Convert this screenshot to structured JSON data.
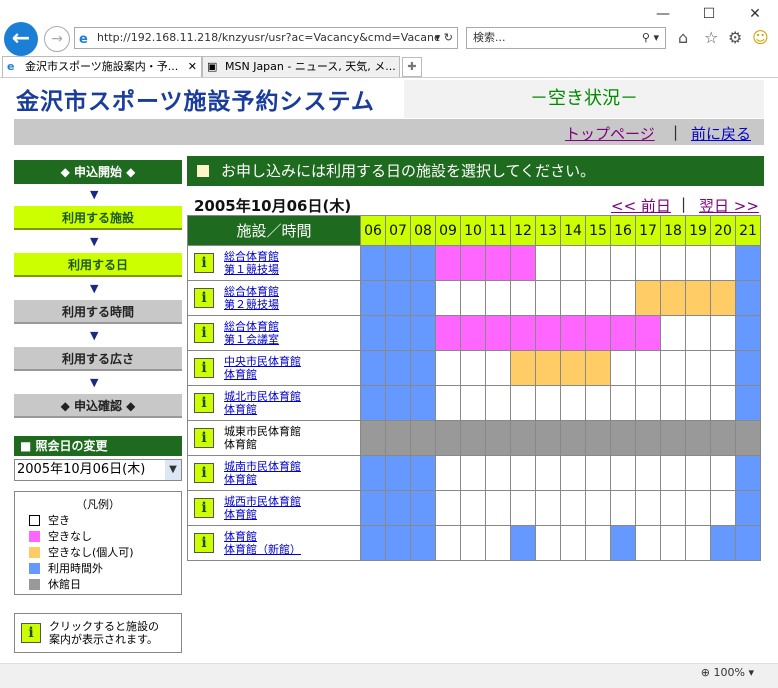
{
  "browser": {
    "address": "http://192.168.11.218/knzyusr/usr?ac=Vacancy&cmd=Vacanc",
    "search_placeholder": "検索...",
    "tabs": [
      {
        "label": "金沢市スポーツ施設案内・予...",
        "active": true
      },
      {
        "label": "MSN Japan - ニュース, 天気, メ...",
        "active": false
      }
    ],
    "zoom": "100%"
  },
  "site": {
    "logo": "金沢市スポーツ施設予約システム",
    "subtitle": "－空き状況－",
    "top_link": "トップページ",
    "back_link": "前に戻る",
    "separator": "|"
  },
  "steps": {
    "start": "◆ 申込開始 ◆",
    "facility": "利用する施設",
    "day": "利用する日",
    "time": "利用する時間",
    "area": "利用する広さ",
    "confirm": "◆ 申込確認 ◆",
    "arrow": "▼"
  },
  "date_change": {
    "header": "■ 照会日の変更",
    "selected": "2005年10月06日(木)"
  },
  "legend": {
    "title": "（凡例）",
    "items": [
      {
        "label": "空き",
        "color": "#ffffff"
      },
      {
        "label": "空きなし",
        "color": "#ff66ff"
      },
      {
        "label": "空きなし(個人可)",
        "color": "#ffcc66"
      },
      {
        "label": "利用時間外",
        "color": "#6699ff"
      },
      {
        "label": "休館日",
        "color": "#999999"
      }
    ]
  },
  "info_note": {
    "line1": "クリックすると施設の",
    "line2": "案内が表示されます。",
    "icon": "i"
  },
  "main": {
    "header": "お申し込みには利用する日の施設を選択してください。",
    "current_date": "2005年10月06日(木)",
    "prev_day": "<< 前日",
    "next_day": "翌日 >>",
    "separator": "|",
    "col_header": "施設／時間",
    "hours": [
      "06",
      "07",
      "08",
      "09",
      "10",
      "11",
      "12",
      "13",
      "14",
      "15",
      "16",
      "17",
      "18",
      "19",
      "20",
      "21"
    ],
    "status_colors": {
      "0": "#ffffff",
      "1": "#ff66ff",
      "2": "#ffcc66",
      "3": "#6699ff",
      "4": "#999999"
    },
    "facilities": [
      {
        "name1": "総合体育館",
        "name2": "第１競技場",
        "link": true,
        "slots": [
          3,
          3,
          3,
          1,
          1,
          1,
          1,
          0,
          0,
          0,
          0,
          0,
          0,
          0,
          0,
          3
        ]
      },
      {
        "name1": "総合体育館",
        "name2": "第２競技場",
        "link": true,
        "slots": [
          3,
          3,
          3,
          0,
          0,
          0,
          0,
          0,
          0,
          0,
          0,
          2,
          2,
          2,
          2,
          3
        ]
      },
      {
        "name1": "総合体育館",
        "name2": "第１会議室",
        "link": true,
        "slots": [
          3,
          3,
          3,
          1,
          1,
          1,
          1,
          1,
          1,
          1,
          1,
          1,
          0,
          0,
          0,
          3
        ]
      },
      {
        "name1": "中央市民体育館",
        "name2": "体育館",
        "link": true,
        "slots": [
          3,
          3,
          3,
          0,
          0,
          0,
          2,
          2,
          2,
          2,
          0,
          0,
          0,
          0,
          0,
          3
        ]
      },
      {
        "name1": "城北市民体育館",
        "name2": "体育館",
        "link": true,
        "slots": [
          3,
          3,
          3,
          0,
          0,
          0,
          0,
          0,
          0,
          0,
          0,
          0,
          0,
          0,
          0,
          3
        ]
      },
      {
        "name1": "城東市民体育館",
        "name2": "体育館",
        "link": false,
        "slots": [
          4,
          4,
          4,
          4,
          4,
          4,
          4,
          4,
          4,
          4,
          4,
          4,
          4,
          4,
          4,
          4
        ]
      },
      {
        "name1": "城南市民体育館",
        "name2": "体育館",
        "link": true,
        "slots": [
          3,
          3,
          3,
          0,
          0,
          0,
          0,
          0,
          0,
          0,
          0,
          0,
          0,
          0,
          0,
          3
        ]
      },
      {
        "name1": "城西市民体育館",
        "name2": "体育館",
        "link": true,
        "slots": [
          3,
          3,
          3,
          0,
          0,
          0,
          0,
          0,
          0,
          0,
          0,
          0,
          0,
          0,
          0,
          3
        ]
      },
      {
        "name1": "体育館",
        "name2": "体育館（新館）",
        "link": true,
        "slots": [
          3,
          3,
          3,
          0,
          0,
          0,
          3,
          0,
          0,
          0,
          3,
          0,
          0,
          0,
          3,
          3
        ]
      }
    ]
  }
}
